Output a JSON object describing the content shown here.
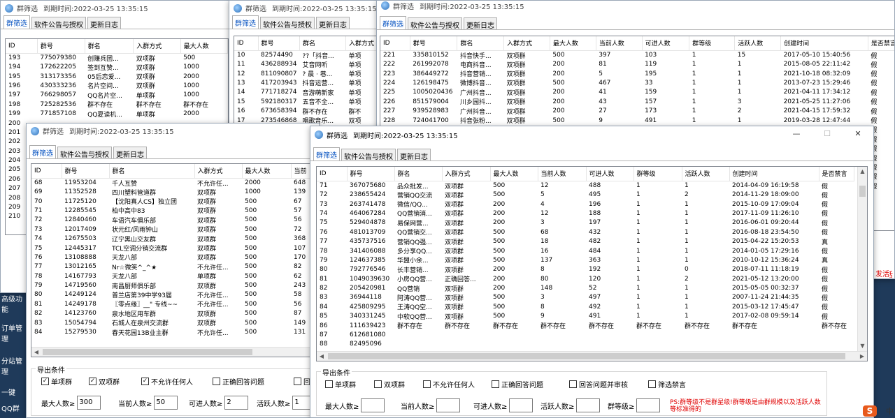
{
  "app_title": "群筛选",
  "expiry": "到期时间:2022-03-25 13:35:15",
  "tabs": [
    "群筛选",
    "软件公告与授权",
    "更新日志"
  ],
  "columns_short": [
    "ID",
    "群号",
    "群名",
    "入群方式",
    "最大人数"
  ],
  "columns_mid": [
    "ID",
    "群号",
    "群名",
    "入群方式",
    "最大人数",
    "当前"
  ],
  "columns_full": [
    "ID",
    "群号",
    "群名",
    "入群方式",
    "最大人数",
    "当前人数",
    "可进人数",
    "群等级",
    "活跃人数",
    "创建时间",
    "是否禁言"
  ],
  "bg_left_labels": [
    "导出",
    "最大",
    "高级功能",
    "订单管理",
    "分站管理",
    "一键",
    "QQ群"
  ],
  "win1": {
    "rows": [
      [
        "193",
        "775079380",
        "创赚兵团...",
        "双项群",
        "500"
      ],
      [
        "194",
        "172622205",
        "签到互赞...",
        "双项群",
        "1000"
      ],
      [
        "195",
        "313173356",
        "05后恋爱...",
        "双项群",
        "2000"
      ],
      [
        "196",
        "430333236",
        "名片空间...",
        "双项群",
        "1000"
      ],
      [
        "197",
        "766298057",
        "QQ名片空...",
        "单项群",
        "1000"
      ],
      [
        "198",
        "725282536",
        "群不存在",
        "群不存在",
        "群不存在"
      ],
      [
        "199",
        "771857108",
        "QQ夏读机...",
        "单项群",
        "2000"
      ],
      [
        "200",
        "",
        "",
        "",
        ""
      ]
    ],
    "more_ids": [
      "200",
      "201",
      "202",
      "203",
      "204",
      "205",
      "206",
      "207",
      "208",
      "209",
      "210"
    ]
  },
  "win2": {
    "rows": [
      [
        "10",
        "82574490",
        "??「抖音...",
        "单项"
      ],
      [
        "11",
        "436288934",
        "艾音网听",
        "单项"
      ],
      [
        "12",
        "811090807",
        "? 晨 · 巷...",
        "单项"
      ],
      [
        "13",
        "417203943",
        "抖音运营...",
        "单项"
      ],
      [
        "14",
        "771718274",
        "音游萌新家",
        "单项"
      ],
      [
        "15",
        "592180317",
        "五音不全...",
        "单项"
      ],
      [
        "16",
        "673658394",
        "群不存在",
        "群不"
      ],
      [
        "17",
        "273546868",
        "唱歌音乐...",
        "双项"
      ]
    ]
  },
  "win3": {
    "rows": [
      [
        "221",
        "335810152",
        "抖音快手...",
        "双项群",
        "500",
        "397",
        "103",
        "1",
        "15",
        "2017-05-10 15:40:56",
        "假"
      ],
      [
        "222",
        "261992078",
        "电商抖音...",
        "双项群",
        "200",
        "81",
        "119",
        "1",
        "1",
        "2015-08-05 22:11:42",
        "假"
      ],
      [
        "223",
        "386449272",
        "抖音营销...",
        "双项群",
        "200",
        "5",
        "195",
        "1",
        "1",
        "2021-10-18 08:32:09",
        "假"
      ],
      [
        "224",
        "126198475",
        "微博抖音...",
        "双项群",
        "500",
        "467",
        "33",
        "1",
        "1",
        "2013-07-23 15:29:46",
        "假"
      ],
      [
        "225",
        "1005020436",
        "广州抖音...",
        "双项群",
        "200",
        "41",
        "159",
        "1",
        "1",
        "2021-04-11 17:34:12",
        "假"
      ],
      [
        "226",
        "851579004",
        "川乡园抖...",
        "双项群",
        "200",
        "43",
        "157",
        "1",
        "3",
        "2021-05-25 11:27:06",
        "假"
      ],
      [
        "227",
        "939528983",
        "广州抖音...",
        "双项群",
        "200",
        "27",
        "173",
        "1",
        "2",
        "2021-04-15 17:59:32",
        "假"
      ],
      [
        "228",
        "724041700",
        "抖音张粉...",
        "双项群",
        "500",
        "9",
        "491",
        "1",
        "1",
        "2019-03-28 12:47:44",
        "假"
      ]
    ],
    "extra_flags": [
      "假",
      "假",
      "假",
      "假",
      "假",
      "假",
      "假"
    ]
  },
  "win4": {
    "rows": [
      [
        "68",
        "11953204",
        "千人互赞",
        "不允许任...",
        "2000",
        "648"
      ],
      [
        "69",
        "11352528",
        "四川塑料管道群",
        "双项群",
        "1000",
        "139"
      ],
      [
        "70",
        "11725120",
        "【沈阳真人CS】独立团",
        "双项群",
        "500",
        "67"
      ],
      [
        "71",
        "12285545",
        "柏中高中83",
        "双项群",
        "500",
        "57"
      ],
      [
        "72",
        "12840460",
        "车语汽车俱乐部",
        "双项群",
        "500",
        "56"
      ],
      [
        "73",
        "12017409",
        "状元红/风雨钟山",
        "双项群",
        "500",
        "72"
      ],
      [
        "74",
        "12675503",
        "辽宁黑山交友群",
        "双项群",
        "500",
        "368"
      ],
      [
        "75",
        "12445317",
        "TCL空调分销交流群",
        "双项群",
        "500",
        "107"
      ],
      [
        "76",
        "13108888",
        "天龙八部",
        "双项群",
        "500",
        "170"
      ],
      [
        "77",
        "13012165",
        "Nr☆微笑^_^★",
        "不允许任...",
        "500",
        "82"
      ],
      [
        "78",
        "14167793",
        "天龙八部",
        "单项群",
        "500",
        "62"
      ],
      [
        "79",
        "14719560",
        "南昌厨师俱乐部",
        "双项群",
        "500",
        "243"
      ],
      [
        "80",
        "14249124",
        "普兰店第39中学93届",
        "不允许任...",
        "500",
        "58"
      ],
      [
        "81",
        "14249178",
        "〖零点缘〗__\" 专线~~",
        "不允许任...",
        "500",
        "56"
      ],
      [
        "82",
        "14123760",
        "泉水地区用车群",
        "双项群",
        "500",
        "87"
      ],
      [
        "83",
        "15054794",
        "石城人在泉州交流群",
        "双项群",
        "500",
        "149"
      ],
      [
        "84",
        "15279530",
        "春天花园13B业主群",
        "不允许任...",
        "500",
        "131"
      ]
    ],
    "export": {
      "title": "导出条件",
      "checks": [
        {
          "label": "单项群",
          "checked": true
        },
        {
          "label": "双项群",
          "checked": true
        },
        {
          "label": "不允许任何人",
          "checked": true
        },
        {
          "label": "正确回答问题",
          "checked": false
        },
        {
          "label": "回答",
          "checked": false
        }
      ],
      "fields": [
        {
          "label": "最大人数≥",
          "value": "300"
        },
        {
          "label": "当前人数≥",
          "value": "50"
        },
        {
          "label": "可进人数≥",
          "value": "2"
        },
        {
          "label": "活跃人数≥",
          "value": "1"
        }
      ]
    }
  },
  "win5": {
    "rows": [
      [
        "71",
        "367075680",
        "品众批发...",
        "双项群",
        "500",
        "12",
        "488",
        "1",
        "1",
        "2014-04-09 16:19:58",
        "假"
      ],
      [
        "72",
        "238655424",
        "营销QQ交流",
        "双项群",
        "500",
        "5",
        "495",
        "1",
        "2",
        "2014-11-29 18:09:00",
        "假"
      ],
      [
        "73",
        "263741478",
        "微信/QQ...",
        "双项群",
        "200",
        "4",
        "196",
        "1",
        "1",
        "2015-10-09 17:09:04",
        "假"
      ],
      [
        "74",
        "464067284",
        "QQ营销消...",
        "双项群",
        "200",
        "12",
        "188",
        "1",
        "1",
        "2017-11-09 11:26:10",
        "假"
      ],
      [
        "75",
        "529404878",
        "易保网营...",
        "双项群",
        "200",
        "3",
        "197",
        "1",
        "1",
        "2016-06-01 09:20:44",
        "假"
      ],
      [
        "76",
        "481013709",
        "QQ营销交...",
        "双项群",
        "500",
        "68",
        "432",
        "1",
        "1",
        "2016-08-18 23:54:50",
        "假"
      ],
      [
        "77",
        "435737516",
        "营销QQ强...",
        "双项群",
        "500",
        "18",
        "482",
        "1",
        "1",
        "2015-04-22 15:20:53",
        "真"
      ],
      [
        "78",
        "341406088",
        "多分享QQ...",
        "双项群",
        "500",
        "16",
        "484",
        "1",
        "1",
        "2014-01-05 17:29:16",
        "假"
      ],
      [
        "79",
        "124637385",
        "华盟小余...",
        "双项群",
        "500",
        "137",
        "363",
        "1",
        "1",
        "2010-10-12 15:36:24",
        "真"
      ],
      [
        "80",
        "792776546",
        "长丰营销...",
        "双项群",
        "200",
        "8",
        "192",
        "1",
        "0",
        "2018-07-11 11:18:19",
        "假"
      ],
      [
        "81",
        "1049039630",
        "小房QQ营...",
        "正确回答...",
        "200",
        "80",
        "120",
        "1",
        "2",
        "2021-05-12 13:20:00",
        "假"
      ],
      [
        "82",
        "205420981",
        "QQ营销",
        "双项群",
        "200",
        "148",
        "52",
        "1",
        "1",
        "2015-05-05 00:32:37",
        "假"
      ],
      [
        "83",
        "36944118",
        "阿涛QQ营...",
        "双项群",
        "500",
        "3",
        "497",
        "1",
        "1",
        "2007-11-24 21:44:35",
        "假"
      ],
      [
        "84",
        "425809295",
        "王涛QQ空...",
        "双项群",
        "500",
        "8",
        "492",
        "1",
        "1",
        "2015-03-12 17:45:47",
        "假"
      ],
      [
        "85",
        "340331245",
        "中软QQ营...",
        "双项群",
        "500",
        "9",
        "491",
        "1",
        "1",
        "2017-02-08 09:59:14",
        "假"
      ],
      [
        "86",
        "111639423",
        "群不存在",
        "群不存在",
        "群不存在",
        "群不存在",
        "群不存在",
        "群不存在",
        "群不存在",
        "群不存在",
        "群不存在"
      ],
      [
        "87",
        "612681080",
        "",
        "",
        "",
        "",
        "",
        "",
        "",
        "",
        ""
      ],
      [
        "88",
        "82495096",
        "",
        "",
        "",
        "",
        "",
        "",
        "",
        "",
        ""
      ]
    ],
    "export": {
      "title": "导出条件",
      "checks": [
        {
          "label": "单项群",
          "checked": false
        },
        {
          "label": "双项群",
          "checked": false
        },
        {
          "label": "不允许任何人",
          "checked": false
        },
        {
          "label": "正确回答问题",
          "checked": false
        },
        {
          "label": "回答问题并审核",
          "checked": false
        },
        {
          "label": "筛选禁言",
          "checked": false
        }
      ],
      "fields": [
        {
          "label": "最大人数≥",
          "value": ""
        },
        {
          "label": "当前人数≥",
          "value": ""
        },
        {
          "label": "可进人数≥",
          "value": ""
        },
        {
          "label": "活跃人数≥",
          "value": ""
        },
        {
          "label": "群等级≥",
          "value": ""
        }
      ],
      "note": "PS:群等级不是群星级!群等级是由群规模以及活跃人数等标准得的"
    },
    "window_buttons": [
      "—",
      "☐",
      "✕"
    ]
  },
  "right_edge_text": "发活",
  "taskbar_icon": "S",
  "taskbar_text": "中",
  "colors": {
    "accent": "#0a55c2",
    "note": "#e00000",
    "desktop": "#1f3a5a"
  }
}
